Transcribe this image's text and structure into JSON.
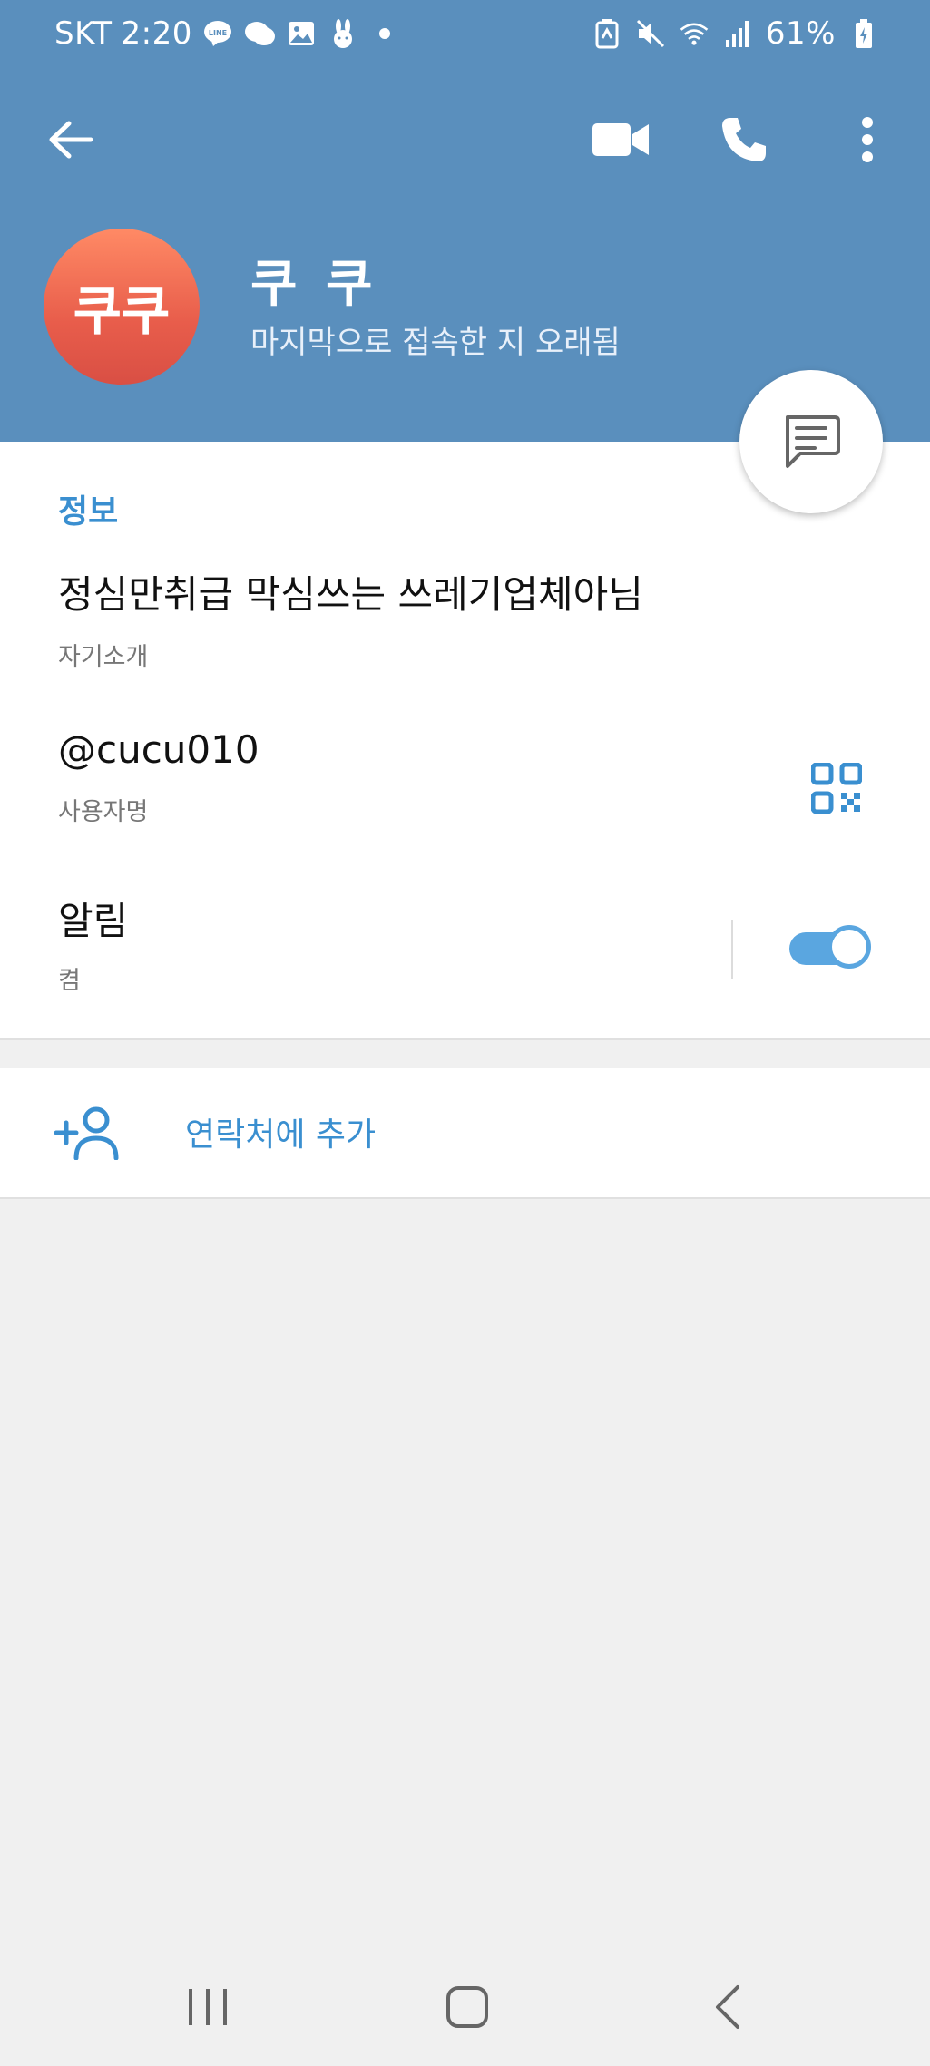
{
  "status_bar": {
    "carrier": "SKT",
    "time": "2:20",
    "battery": "61%"
  },
  "profile": {
    "avatar_initials": "쿠쿠",
    "name": "쿠 쿠",
    "last_seen": "마지막으로 접속한 지 오래됨"
  },
  "info": {
    "section_title": "정보",
    "bio": "정심만취급 막심쓰는 쓰레기업체아님",
    "bio_label": "자기소개",
    "username": "@cucu010",
    "username_label": "사용자명",
    "notifications": "알림",
    "notifications_state": "켬"
  },
  "actions": {
    "add_contact": "연락처에 추가"
  },
  "colors": {
    "header": "#5a8fbd",
    "accent": "#3a8fd0",
    "avatar": "#e85d4b"
  }
}
